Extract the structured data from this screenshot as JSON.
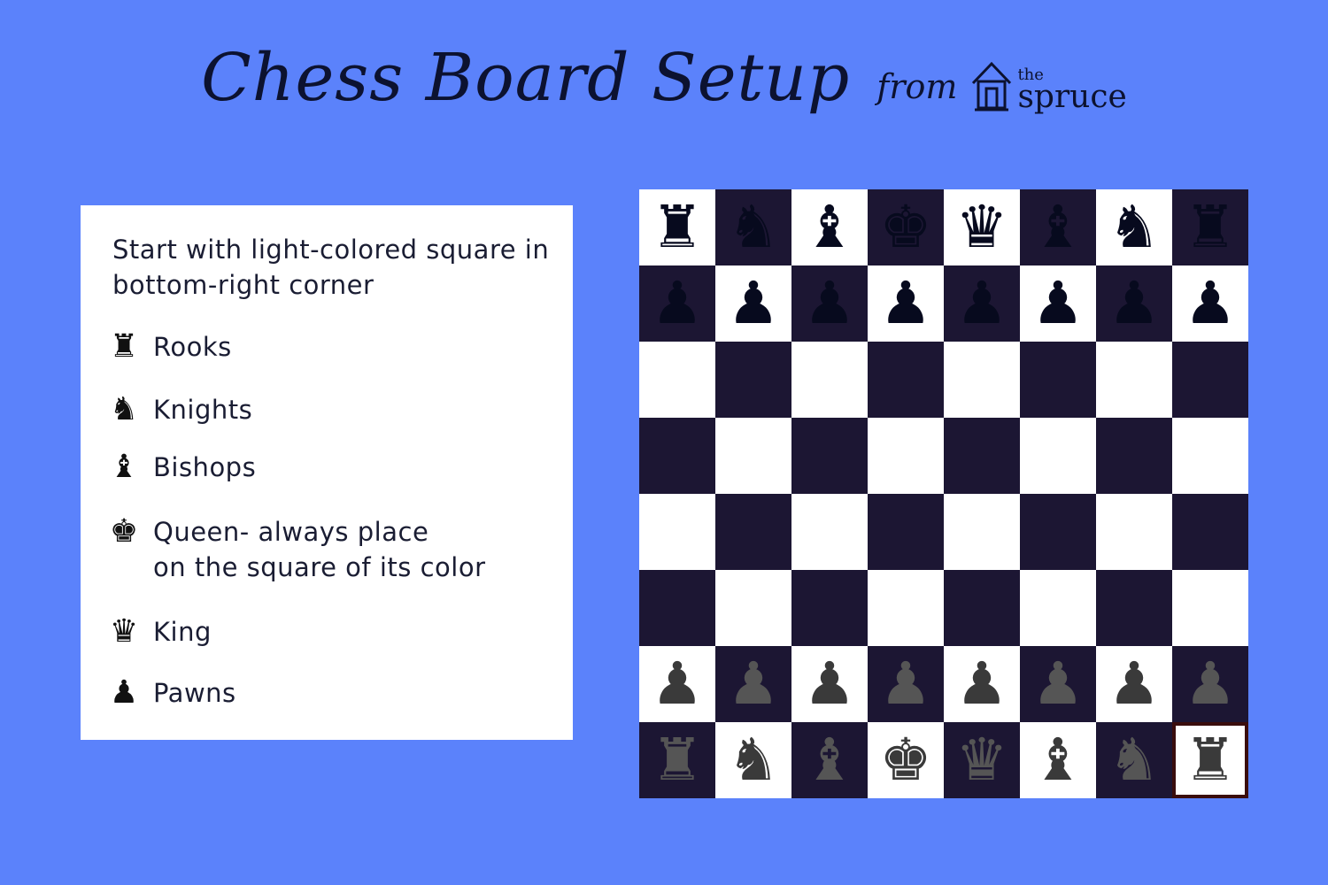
{
  "header": {
    "title": "Chess Board Setup",
    "from": "from",
    "logo_the": "the",
    "logo_name": "spruce"
  },
  "legend": {
    "intro": "Start with light-colored square in bottom-right corner",
    "items": [
      {
        "icon": "rook-icon",
        "glyph": "♜",
        "label": "Rooks"
      },
      {
        "icon": "knight-icon",
        "glyph": "♞",
        "label": "Knights"
      },
      {
        "icon": "bishop-icon",
        "glyph": "♝",
        "label": "Bishops"
      },
      {
        "icon": "queen-icon",
        "glyph": "♚",
        "label": "Queen- always place\non the square of its color"
      },
      {
        "icon": "king-icon",
        "glyph": "♛",
        "label": "King"
      },
      {
        "icon": "pawn-icon",
        "glyph": "♟",
        "label": "Pawns"
      }
    ]
  },
  "board": {
    "light_color": "#ffffff",
    "dark_color": "#1c1633",
    "highlight_square": "bottom-right",
    "rows": [
      [
        "black-rook",
        "black-knight",
        "black-bishop",
        "black-king",
        "black-queen",
        "black-bishop",
        "black-knight",
        "black-rook"
      ],
      [
        "black-pawn",
        "black-pawn",
        "black-pawn",
        "black-pawn",
        "black-pawn",
        "black-pawn",
        "black-pawn",
        "black-pawn"
      ],
      [
        "",
        "",
        "",
        "",
        "",
        "",
        "",
        ""
      ],
      [
        "",
        "",
        "",
        "",
        "",
        "",
        "",
        ""
      ],
      [
        "",
        "",
        "",
        "",
        "",
        "",
        "",
        ""
      ],
      [
        "",
        "",
        "",
        "",
        "",
        "",
        "",
        ""
      ],
      [
        "gray-pawn",
        "gray-pawn",
        "gray-pawn",
        "gray-pawn",
        "gray-pawn",
        "gray-pawn",
        "gray-pawn",
        "gray-pawn"
      ],
      [
        "gray-rook",
        "gray-knight",
        "gray-bishop",
        "gray-king",
        "gray-queen",
        "gray-bishop",
        "gray-knight",
        "gray-rook"
      ]
    ]
  }
}
